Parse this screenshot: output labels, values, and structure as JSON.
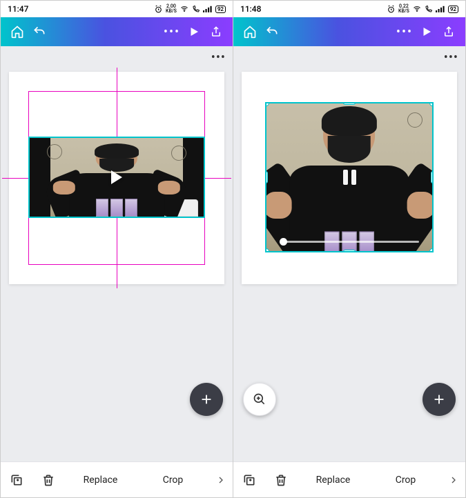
{
  "screens": [
    {
      "status": {
        "time": "11:47",
        "speed_num": "2.00",
        "speed_unit": "KB/S",
        "battery": "92"
      },
      "bottom": {
        "replace": "Replace",
        "crop": "Crop"
      }
    },
    {
      "status": {
        "time": "11:48",
        "speed_num": "0.22",
        "speed_unit": "KB/S",
        "battery": "92"
      },
      "bottom": {
        "replace": "Replace",
        "crop": "Crop"
      }
    }
  ]
}
